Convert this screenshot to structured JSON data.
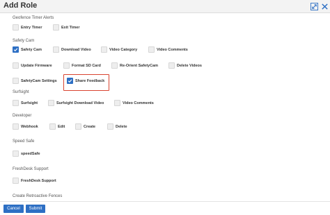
{
  "dialog": {
    "title": "Add Role",
    "expand_icon": "expand-icon",
    "close_icon": "close-icon"
  },
  "sections": {
    "geofence": {
      "label": "Geofence Timer Alerts",
      "items": [
        {
          "label": "Entry Timer",
          "checked": false
        },
        {
          "label": "Exit Timer",
          "checked": false
        }
      ]
    },
    "safety_cam": {
      "label": "Safety Cam",
      "items": [
        {
          "label": "Safety Cam",
          "checked": true
        },
        {
          "label": "Download Video",
          "checked": false
        },
        {
          "label": "Video Category",
          "checked": false
        },
        {
          "label": "Video Comments",
          "checked": false
        },
        {
          "label": "Update Firmware",
          "checked": false
        },
        {
          "label": "Format SD Card",
          "checked": false
        },
        {
          "label": "Re-Orient SafetyCam",
          "checked": false
        },
        {
          "label": "Delete Videos",
          "checked": false
        },
        {
          "label": "SafetyCam Settings",
          "checked": false
        },
        {
          "label": "Share Feedback",
          "checked": true
        }
      ]
    },
    "surfsight": {
      "label": "Surfsight",
      "items": [
        {
          "label": "Surfsight",
          "checked": false
        },
        {
          "label": "Surfsight Download Video",
          "checked": false
        },
        {
          "label": "Video Comments",
          "checked": false
        }
      ]
    },
    "developer": {
      "label": "Developer",
      "items": [
        {
          "label": "Webhook",
          "checked": false
        },
        {
          "label": "Edit",
          "checked": false
        },
        {
          "label": "Create",
          "checked": false
        },
        {
          "label": "Delete",
          "checked": false
        }
      ]
    },
    "speed_safe": {
      "label": "Speed Safe",
      "items": [
        {
          "label": "speedSafe",
          "checked": false
        }
      ]
    },
    "freshdesk": {
      "label": "FreshDesk Support",
      "items": [
        {
          "label": "FreshDesk Support",
          "checked": false
        }
      ]
    },
    "retroactive": {
      "label": "Create Retroactive Fences"
    }
  },
  "footer": {
    "cancel_label": "Cancel",
    "submit_label": "Submit"
  },
  "colors": {
    "primary": "#2d6fc4",
    "highlight_border": "#d9432f",
    "checkbox_unchecked": "#eeeeee"
  }
}
